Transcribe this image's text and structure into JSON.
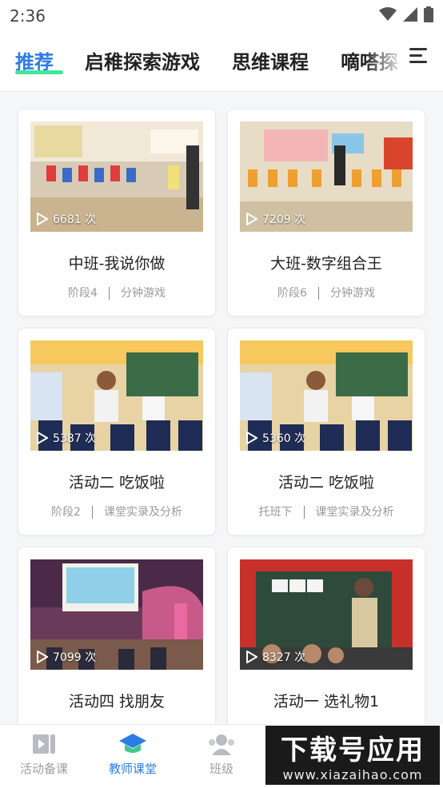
{
  "status": {
    "time": "2:36"
  },
  "tabs": [
    {
      "label": "推荐",
      "active": true
    },
    {
      "label": "启稚探索游戏"
    },
    {
      "label": "思维课程"
    },
    {
      "label": "嘀嗒探"
    }
  ],
  "cards": [
    {
      "views": "6681 次",
      "title": "中班-我说你做",
      "tag1": "阶段4",
      "tag2": "分钟游戏"
    },
    {
      "views": "7209 次",
      "title": "大班-数字组合王",
      "tag1": "阶段6",
      "tag2": "分钟游戏"
    },
    {
      "views": "5387 次",
      "title": "活动二 吃饭啦",
      "tag1": "阶段2",
      "tag2": "课堂实录及分析"
    },
    {
      "views": "5360 次",
      "title": "活动二 吃饭啦",
      "tag1": "托班下",
      "tag2": "课堂实录及分析"
    },
    {
      "views": "7099 次",
      "title": "活动四 找朋友",
      "tag1": "",
      "tag2": ""
    },
    {
      "views": "8327 次",
      "title": "活动一 选礼物1",
      "tag1": "",
      "tag2": ""
    }
  ],
  "bottom_nav": [
    {
      "label": "活动备课",
      "icon": "video-icon"
    },
    {
      "label": "教师课堂",
      "icon": "graduation-cap-icon",
      "active": true
    },
    {
      "label": "班级",
      "icon": "class-icon"
    }
  ],
  "watermark": {
    "title": "下载号应用",
    "url": "www.xiazaihao.com"
  },
  "colors": {
    "accent": "#2d7be5",
    "underline": "#42e59c"
  }
}
